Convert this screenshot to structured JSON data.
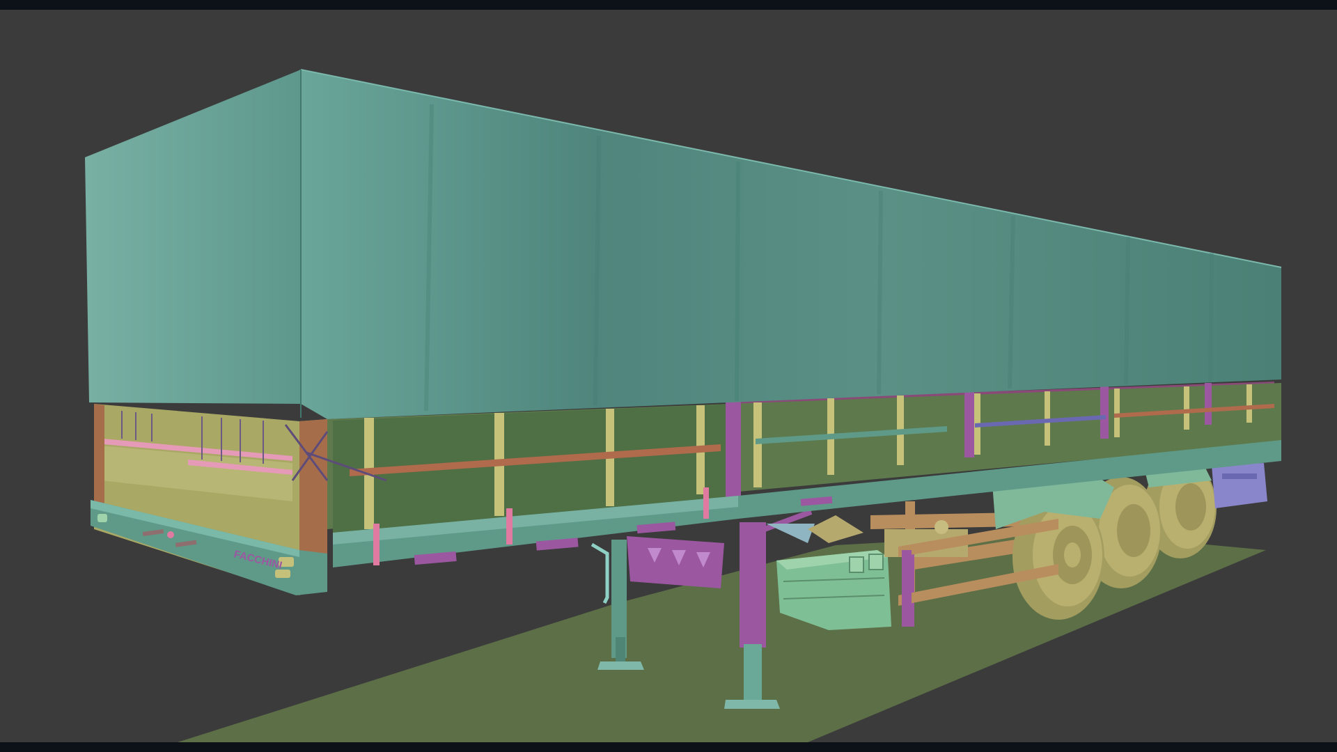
{
  "scene": {
    "subject": "semi-trailer",
    "trailer_side_logo": "FACCHINI",
    "colors": {
      "viewport_bg": "#3b3b3b",
      "frame_bar": "#0d1218",
      "tarp": "#5a8f84",
      "tarp_top": "#5d948a",
      "tarp_front": "#6fa79b",
      "ground_plane": "#5d6f47",
      "side_panel": "#5e7a4d",
      "wall_purple": "#8a4a78",
      "post_yellow": "#c6c27a",
      "rail_orange": "#b06a4c",
      "chassis_teal": "#5f9a89",
      "leg_purple": "#9c57a1",
      "wheel": "#b9b06f",
      "fender": "#7fb99a",
      "tank": "#7fbf95",
      "front_panel": "#a9a865",
      "corner_brown": "#a66d4b",
      "tan_frame": "#b98e5e"
    }
  }
}
